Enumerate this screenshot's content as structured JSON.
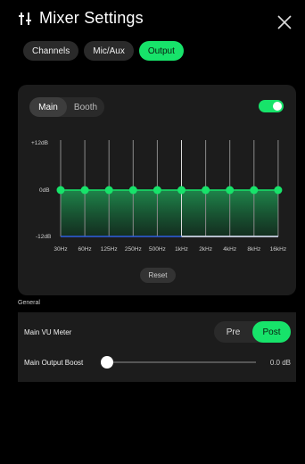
{
  "header": {
    "title": "Mixer Settings"
  },
  "tabs": [
    {
      "label": "Channels",
      "active": false
    },
    {
      "label": "Mic/Aux",
      "active": false
    },
    {
      "label": "Output",
      "active": true
    }
  ],
  "eq": {
    "modes": [
      {
        "label": "Main",
        "active": true
      },
      {
        "label": "Booth",
        "active": false
      }
    ],
    "enabled": true,
    "db_labels": {
      "top": "+12dB",
      "mid": "0dB",
      "bottom": "-12dB"
    },
    "bands": [
      "30Hz",
      "60Hz",
      "125Hz",
      "250Hz",
      "500Hz",
      "1kHz",
      "2kHz",
      "4kHz",
      "8kHz",
      "16kHz"
    ],
    "gains_db": [
      0,
      0,
      0,
      0,
      0,
      0,
      0,
      0,
      0,
      0
    ],
    "reset_label": "Reset",
    "accent": "#17e36a"
  },
  "general": {
    "section_label": "General",
    "vu_meter": {
      "label": "Main VU Meter",
      "options": [
        "Pre",
        "Post"
      ],
      "selected": "Post"
    },
    "output_boost": {
      "label": "Main Output Boost",
      "value": 0.0,
      "display": "0.0 dB"
    }
  }
}
